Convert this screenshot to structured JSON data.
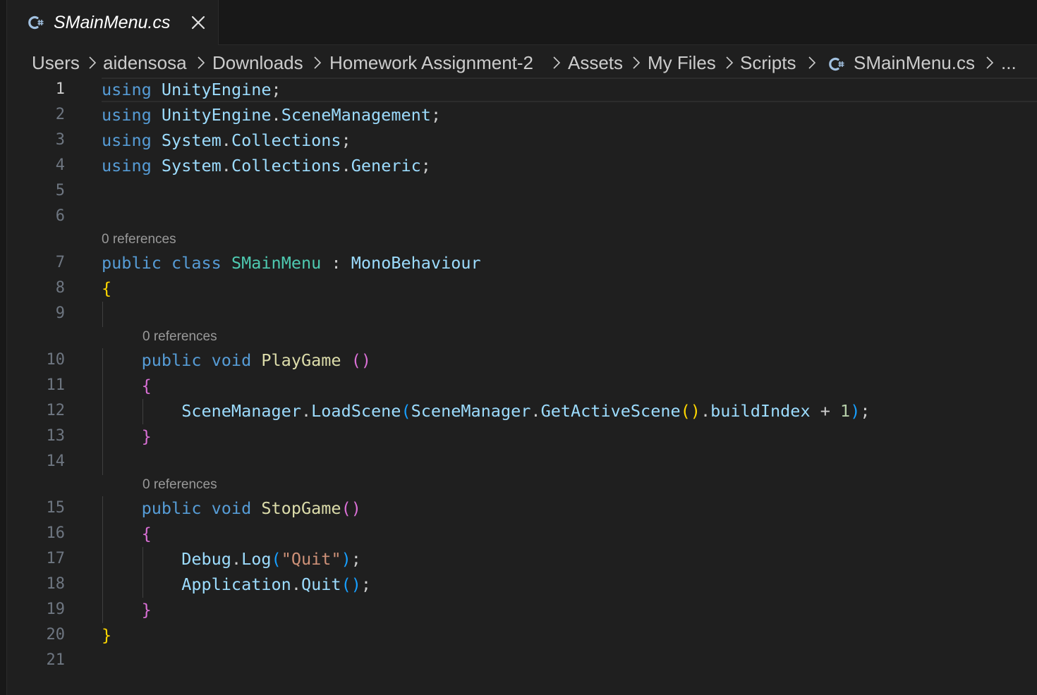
{
  "tab": {
    "label": "SMainMenu.cs",
    "icon": "csharp-file-icon",
    "close_icon": "close-icon"
  },
  "breadcrumb": {
    "items": [
      "Users",
      "aidensosa",
      "Downloads",
      "Homework Assignment-2",
      "Assets",
      "My Files",
      "Scripts",
      "SMainMenu.cs",
      "..."
    ]
  },
  "editor": {
    "code_lens": "0 references",
    "line_numbers": [
      "1",
      "2",
      "3",
      "4",
      "5",
      "6",
      "7",
      "8",
      "9",
      "10",
      "11",
      "12",
      "13",
      "14",
      "15",
      "16",
      "17",
      "18",
      "19",
      "20",
      "21"
    ],
    "active_line": "1",
    "lines": [
      [
        "using",
        " ",
        "UnityEngine",
        ";"
      ],
      [
        "using",
        " ",
        "UnityEngine",
        ".",
        "SceneManagement",
        ";"
      ],
      [
        "using",
        " ",
        "System",
        ".",
        "Collections",
        ";"
      ],
      [
        "using",
        " ",
        "System",
        ".",
        "Collections",
        ".",
        "Generic",
        ";"
      ],
      [],
      [],
      [
        "public",
        " ",
        "class",
        " ",
        "SMainMenu",
        " : ",
        "MonoBehaviour"
      ],
      [
        "{"
      ],
      [],
      [
        "    ",
        "public",
        " ",
        "void",
        " ",
        "PlayGame",
        " ",
        "(",
        ")"
      ],
      [
        "    ",
        "{"
      ],
      [
        "        ",
        "SceneManager",
        ".",
        "LoadScene",
        "(",
        "SceneManager",
        ".",
        "GetActiveScene",
        "(",
        ")",
        ".",
        "buildIndex",
        " + ",
        "1",
        ")",
        ";"
      ],
      [
        "    ",
        "}"
      ],
      [],
      [
        "    ",
        "public",
        " ",
        "void",
        " ",
        "StopGame",
        "(",
        ")"
      ],
      [
        "    ",
        "{"
      ],
      [
        "        ",
        "Debug",
        ".",
        "Log",
        "(",
        "\"Quit\"",
        ")",
        ";"
      ],
      [
        "        ",
        "Application",
        ".",
        "Quit",
        "(",
        ")",
        ";"
      ],
      [
        "    ",
        "}"
      ],
      [
        "}"
      ],
      []
    ]
  },
  "colors": {
    "background": "#1f1f1f",
    "keyword": "#569cd6",
    "identifier": "#9cdcfe",
    "type": "#4ec9b0",
    "function": "#dcdcaa",
    "string": "#ce9178",
    "number": "#b5cea8",
    "bracket_level1": "#ffd700",
    "bracket_level2": "#da70d6",
    "bracket_level3": "#179fff"
  }
}
